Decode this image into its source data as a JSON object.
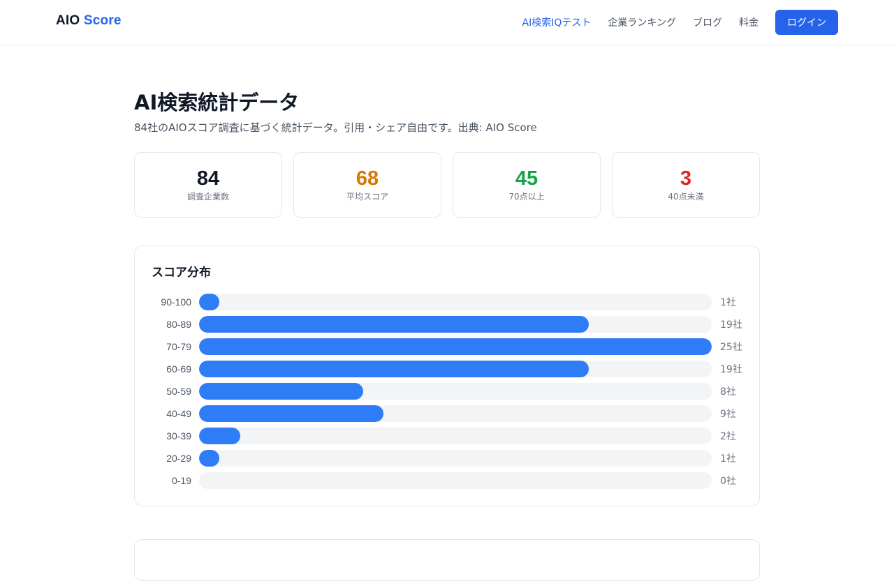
{
  "header": {
    "logo_part1": "AIO",
    "logo_part2": "Score",
    "nav": [
      {
        "label": "AI検索IQテスト",
        "active": true
      },
      {
        "label": "企業ランキング",
        "active": false
      },
      {
        "label": "ブログ",
        "active": false
      },
      {
        "label": "料金",
        "active": false
      }
    ],
    "login_label": "ログイン"
  },
  "page": {
    "title": "AI検索統計データ",
    "subtitle": "84社のAIOスコア調査に基づく統計データ。引用・シェア自由です。出典: AIO Score"
  },
  "stats": [
    {
      "value": "84",
      "label": "調査企業数",
      "color": "#111827"
    },
    {
      "value": "68",
      "label": "平均スコア",
      "color": "#d97706"
    },
    {
      "value": "45",
      "label": "70点以上",
      "color": "#16a34a"
    },
    {
      "value": "3",
      "label": "40点未満",
      "color": "#dc2626"
    }
  ],
  "distribution": {
    "title": "スコア分布",
    "max": 25,
    "rows": [
      {
        "range": "90-100",
        "count": 1,
        "count_label": "1社"
      },
      {
        "range": "80-89",
        "count": 19,
        "count_label": "19社"
      },
      {
        "range": "70-79",
        "count": 25,
        "count_label": "25社"
      },
      {
        "range": "60-69",
        "count": 19,
        "count_label": "19社"
      },
      {
        "range": "50-59",
        "count": 8,
        "count_label": "8社"
      },
      {
        "range": "40-49",
        "count": 9,
        "count_label": "9社"
      },
      {
        "range": "30-39",
        "count": 2,
        "count_label": "2社"
      },
      {
        "range": "20-29",
        "count": 1,
        "count_label": "1社"
      },
      {
        "range": "0-19",
        "count": 0,
        "count_label": "0社"
      }
    ]
  },
  "colors": {
    "accent": "#2563eb",
    "bar": "#2e7cf6",
    "track": "#f3f4f6"
  }
}
